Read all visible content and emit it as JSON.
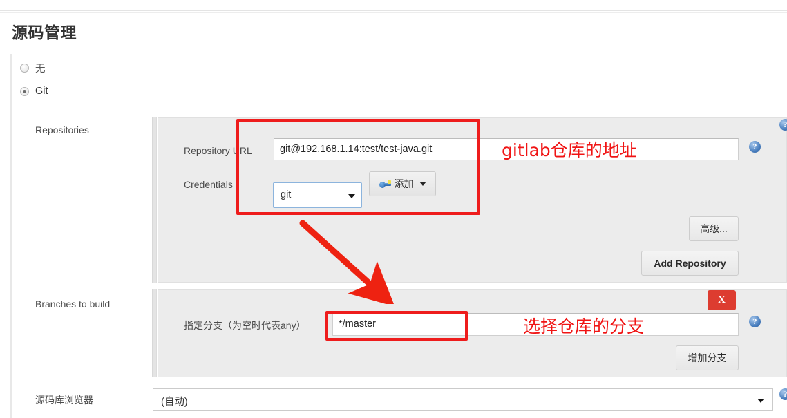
{
  "page": {
    "title": "源码管理"
  },
  "scm_options": [
    {
      "label": "无",
      "selected": false
    },
    {
      "label": "Git",
      "selected": true
    }
  ],
  "sections": {
    "repositories": {
      "label": "Repositories",
      "repository_url": {
        "label": "Repository URL",
        "value": "git@192.168.1.14:test/test-java.git"
      },
      "credentials": {
        "label": "Credentials",
        "selected": "git",
        "add_button": "添加",
        "add_icon": "key-icon",
        "caret_icon": "chevron-down-icon"
      },
      "advanced_button": "高级...",
      "add_repository_button": "Add Repository",
      "help_icon": "help-icon"
    },
    "branches": {
      "label": "Branches to build",
      "branch_spec": {
        "label": "指定分支（为空时代表any）",
        "value": "*/master"
      },
      "add_branch_button": "增加分支",
      "delete_button": "X",
      "help_icon": "help-icon"
    },
    "browser": {
      "label": "源码库浏览器",
      "selected": "(自动)",
      "caret_icon": "chevron-down-icon",
      "help_icon": "help-icon"
    }
  },
  "annotations": {
    "repo_note": "gitlab仓库的地址",
    "branch_note": "选择仓库的分支",
    "arrow_icon": "red-arrow-icon",
    "color": "#f01414"
  }
}
